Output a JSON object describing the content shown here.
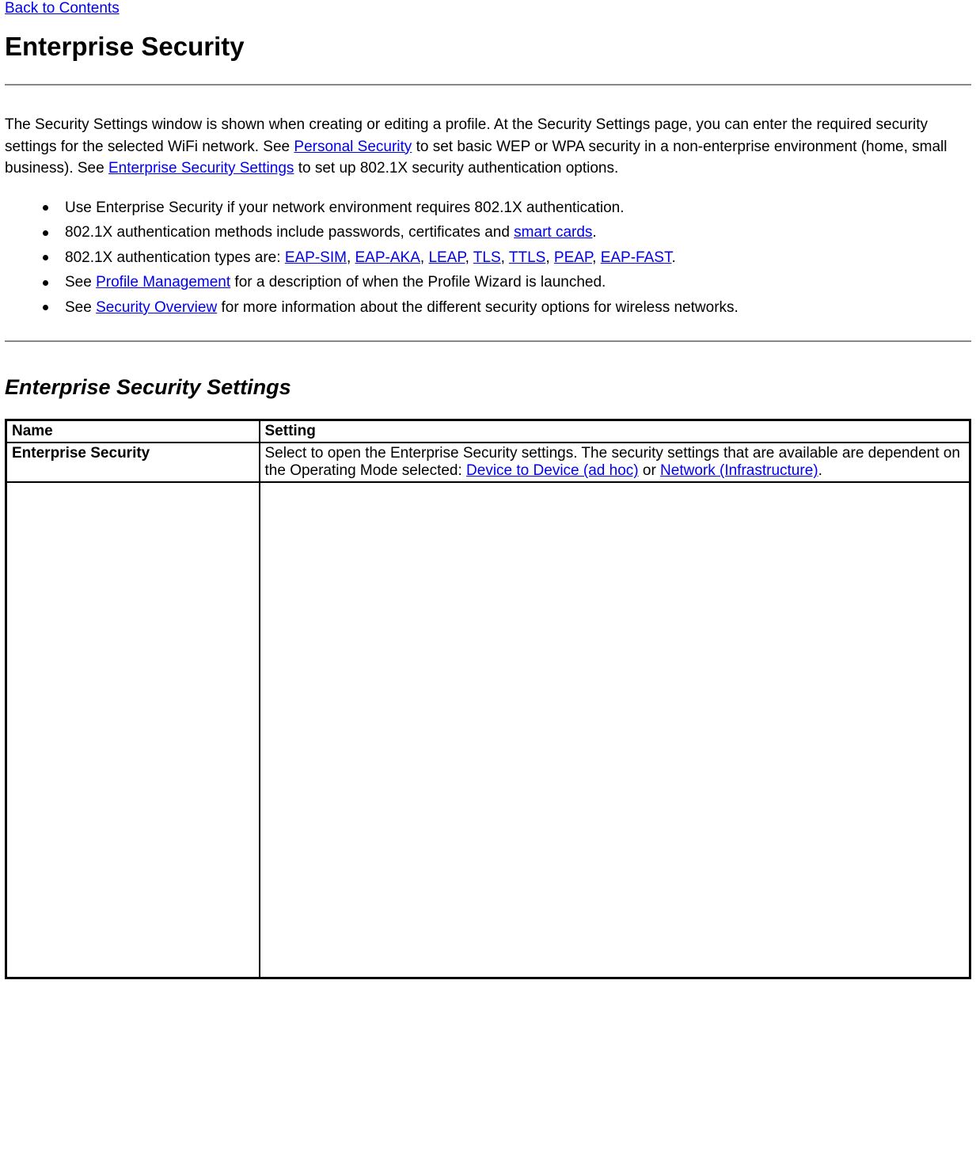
{
  "nav": {
    "back_to_contents": "Back to Contents"
  },
  "title": "Enterprise Security",
  "intro": {
    "t1": "The Security Settings window is shown when creating or editing a profile. At the Security Settings page, you can enter the required security settings for the selected WiFi network. See ",
    "link_personal": "Personal Security",
    "t2": " to set basic WEP or WPA security in a non-enterprise environment (home, small business). See ",
    "link_ent_settings": "Enterprise Security Settings",
    "t3": " to set up 802.1X security authentication options."
  },
  "bullets": {
    "b1": "Use Enterprise Security if your network environment requires 802.1X authentication.",
    "b2_a": "802.1X authentication methods include passwords, certificates and ",
    "b2_link": "smart cards",
    "b2_b": ".",
    "b3_a": "802.1X authentication types are: ",
    "b3_sep": ", ",
    "b3_end": ".",
    "b3_links": {
      "eap_sim": "EAP-SIM",
      "eap_aka": "EAP-AKA",
      "leap": "LEAP",
      "tls": "TLS",
      "ttls": "TTLS",
      "peap": "PEAP",
      "eap_fast": "EAP-FAST"
    },
    "b4_a": "See ",
    "b4_link": "Profile Management",
    "b4_b": " for a description of when the Profile Wizard is launched.",
    "b5_a": "See ",
    "b5_link": "Security Overview",
    "b5_b": " for more information about the different security options for wireless networks."
  },
  "section2_title": "Enterprise Security Settings",
  "table": {
    "head_name": "Name",
    "head_setting": "Setting",
    "row1": {
      "name": "Enterprise Security",
      "val_a": "Select to open the Enterprise Security settings. The security settings that are available are dependent on the Operating Mode selected: ",
      "link_adhoc": "Device to Device (ad hoc)",
      "val_or": " or ",
      "link_infra": "Network (Infrastructure)",
      "val_end": "."
    }
  }
}
